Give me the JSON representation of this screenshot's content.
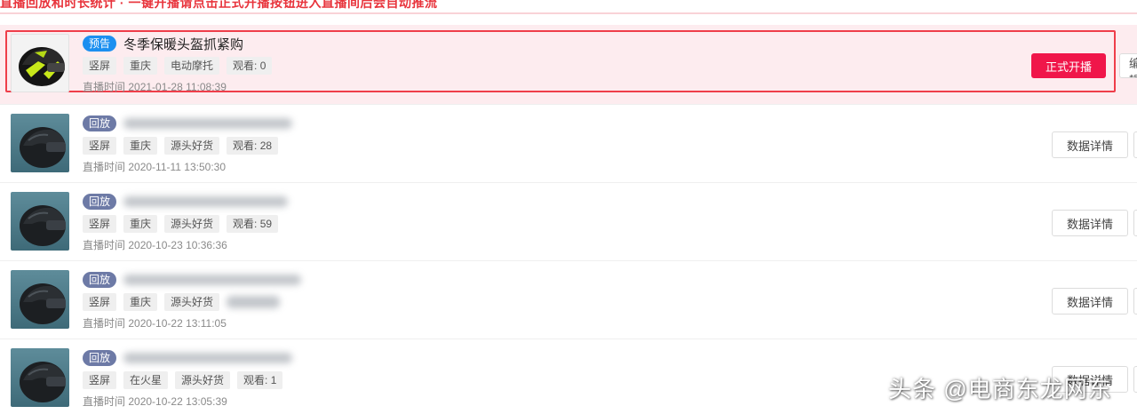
{
  "banner": {
    "text": "直播回放和时长统计 · 一键开播请点击正式开播按钮进入直播间后会自动推流"
  },
  "rows": [
    {
      "status": "预告",
      "title": "冬季保暖头盔抓紧购",
      "tags": [
        "竖屏",
        "重庆",
        "电动摩托",
        "观看: 0"
      ],
      "time_label": "直播时间",
      "time": "2021-01-28 11:08:39",
      "primary_button": "正式开播",
      "secondary_button": "编辑"
    },
    {
      "status": "回放",
      "title": "",
      "tags": [
        "竖屏",
        "重庆",
        "源头好货",
        "观看: 28"
      ],
      "time_label": "直播时间",
      "time": "2020-11-11 13:50:30",
      "button": "数据详情"
    },
    {
      "status": "回放",
      "title": "",
      "tags": [
        "竖屏",
        "重庆",
        "源头好货",
        "观看: 59"
      ],
      "time_label": "直播时间",
      "time": "2020-10-23 10:36:36",
      "button": "数据详情"
    },
    {
      "status": "回放",
      "title": "",
      "tags": [
        "竖屏",
        "重庆",
        "源头好货"
      ],
      "time_label": "直播时间",
      "time": "2020-10-22 13:11:05",
      "button": "数据详情"
    },
    {
      "status": "回放",
      "title": "",
      "tags": [
        "竖屏",
        "在火星",
        "源头好货",
        "观看: 1"
      ],
      "time_label": "直播时间",
      "time": "2020-10-22 13:05:39",
      "button": "数据详情"
    }
  ],
  "watermark": "头条 @电商东龙网东",
  "colors": {
    "accent_red": "#f0164a",
    "preview_blue": "#1b8ff0",
    "replay_slate": "#6d7aa6",
    "highlight_bg": "#fdecef"
  },
  "icons": {
    "thumbnail_1": "motorcycle-helmet-green-black",
    "thumbnail_other": "motorcycle-helmet-black"
  }
}
